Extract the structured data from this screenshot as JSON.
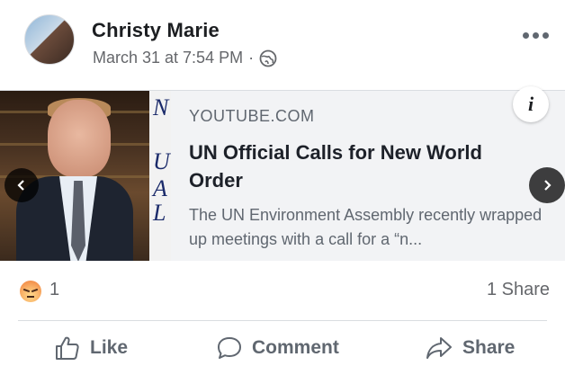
{
  "post": {
    "author": "Christy Marie",
    "timestamp": "March 31 at 7:54 PM",
    "separator": "·",
    "privacy_icon": "globe-icon",
    "more_icon": "more-options-icon"
  },
  "link_preview": {
    "domain": "YOUTUBE.COM",
    "title": "UN Official Calls for New World Order",
    "description": "The UN Environment Assembly recently wrapped up meetings with a call for a “n...",
    "side_strip_letters": [
      "N",
      "U",
      "A",
      "L"
    ]
  },
  "stats": {
    "reaction_icon": "angry-reaction-icon",
    "reaction_count": "1",
    "shares": "1 Share"
  },
  "actions": {
    "like": "Like",
    "comment": "Comment",
    "share": "Share"
  },
  "colors": {
    "secondary_text": "#65676b",
    "card_bg": "#f2f3f5",
    "divider": "#dadde1"
  }
}
